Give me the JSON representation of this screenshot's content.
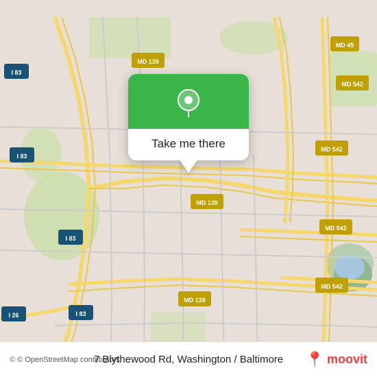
{
  "map": {
    "background_color": "#e8e0d8",
    "attribution": "© OpenStreetMap contributors",
    "address": "7 Blythewood Rd, Washington / Baltimore",
    "center_lat": 39.37,
    "center_lng": -76.62
  },
  "popup": {
    "button_label": "Take me there",
    "pin_icon": "location-pin"
  },
  "branding": {
    "logo_text": "moovit",
    "logo_color": "#e84040"
  },
  "road_labels": [
    "I 83",
    "I 83",
    "I 83",
    "I 83",
    "MD 45",
    "MD 139",
    "MD 139",
    "MD 139",
    "MD 542",
    "MD 542",
    "MD 542",
    "MD 542",
    "I 26"
  ]
}
